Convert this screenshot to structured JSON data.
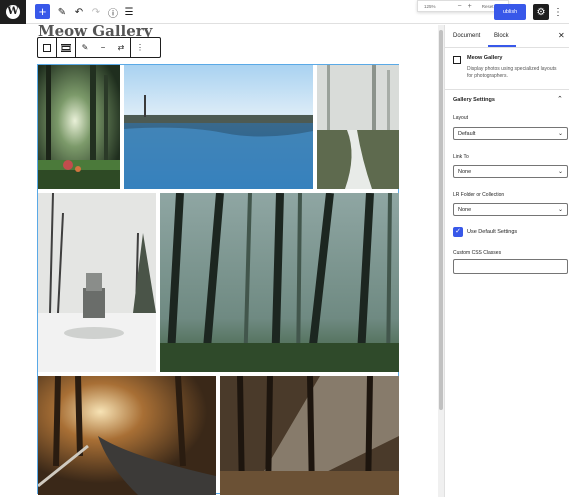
{
  "toolbar": {
    "logo_glyph": "W",
    "add_glyph": "+",
    "edit_glyph": "✎",
    "undo_glyph": "↶",
    "redo_glyph": "↷",
    "info_glyph": "ⓘ",
    "list_glyph": "☰",
    "zoom": {
      "level": "125%",
      "minus": "−",
      "plus": "+",
      "reset": "Reset"
    },
    "publish_label": "ublish",
    "settings_glyph": "⚙",
    "more_glyph": "⋮"
  },
  "editor": {
    "post_title": "Meow Gallery",
    "block_toolbar": {
      "edit_glyph": "✎",
      "minus_glyph": "−",
      "swap_glyph": "⇄",
      "more_glyph": "⋮"
    },
    "photos": [
      {
        "name": "sunlit-forest-photo"
      },
      {
        "name": "winter-lake-photo"
      },
      {
        "name": "snowy-forest-path-photo"
      },
      {
        "name": "snowy-park-photo"
      },
      {
        "name": "misty-forest-photo"
      },
      {
        "name": "autumn-road-photo"
      },
      {
        "name": "sunbeam-woods-photo"
      }
    ]
  },
  "sidebar": {
    "tabs": [
      "Document",
      "Block"
    ],
    "active_tab": "Block",
    "close_glyph": "✕",
    "block": {
      "name": "Meow Gallery",
      "description": "Display photos using specialized layouts for photographers."
    },
    "panel_title": "Gallery Settings",
    "panel_chevron": "⌃",
    "fields": [
      {
        "label": "Layout",
        "value": "Default"
      },
      {
        "label": "Link To",
        "value": "None"
      },
      {
        "label": "LR Folder or Collection",
        "value": "None"
      }
    ],
    "select_caret": "⌄",
    "checkbox_label": "Use Default Settings",
    "checkbox_glyph": "✓",
    "custom_css_label": "Custom CSS Classes"
  },
  "colors": {
    "accent": "#3858e9",
    "selection": "#5aa9e6"
  }
}
